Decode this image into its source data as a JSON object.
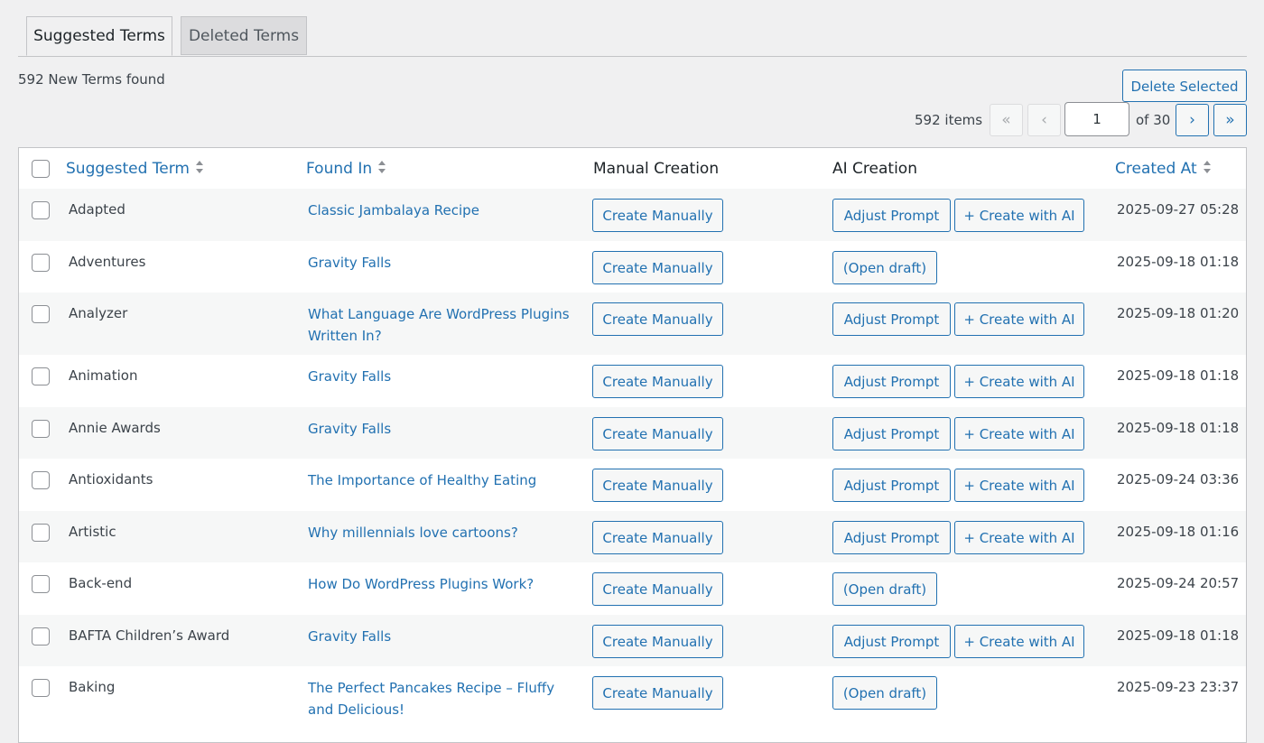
{
  "tabs": {
    "suggested": "Suggested Terms",
    "deleted": "Deleted Terms"
  },
  "summary": "592 New Terms found",
  "actions": {
    "delete_selected": "Delete Selected"
  },
  "pagination": {
    "items": "592 items",
    "first": "«",
    "prev": "‹",
    "current_page": "1",
    "of_total": "of 30",
    "next": "›",
    "last": "»"
  },
  "columns": {
    "suggested_term": "Suggested Term",
    "found_in": "Found In",
    "manual_creation": "Manual Creation",
    "ai_creation": "AI Creation",
    "created_at": "Created At"
  },
  "buttons": {
    "create_manually": "Create Manually",
    "adjust_prompt": "Adjust Prompt",
    "create_with_ai": "+ Create with AI",
    "open_draft": "(Open draft)"
  },
  "rows": [
    {
      "term": "Adapted",
      "found_in": "Classic Jambalaya Recipe",
      "draft": false,
      "created_at": "2025-09-27 05:28"
    },
    {
      "term": "Adventures",
      "found_in": "Gravity Falls",
      "draft": true,
      "created_at": "2025-09-18 01:18"
    },
    {
      "term": "Analyzer",
      "found_in": "What Language Are WordPress Plugins Written In?",
      "draft": false,
      "created_at": "2025-09-18 01:20"
    },
    {
      "term": "Animation",
      "found_in": "Gravity Falls",
      "draft": false,
      "created_at": "2025-09-18 01:18"
    },
    {
      "term": "Annie Awards",
      "found_in": "Gravity Falls",
      "draft": false,
      "created_at": "2025-09-18 01:18"
    },
    {
      "term": "Antioxidants",
      "found_in": "The Importance of Healthy Eating",
      "draft": false,
      "created_at": "2025-09-24 03:36"
    },
    {
      "term": "Artistic",
      "found_in": "Why millennials love cartoons?",
      "draft": false,
      "created_at": "2025-09-18 01:16"
    },
    {
      "term": "Back-end",
      "found_in": "How Do WordPress Plugins Work?",
      "draft": true,
      "created_at": "2025-09-24 20:57"
    },
    {
      "term": "BAFTA Children’s Award",
      "found_in": "Gravity Falls",
      "draft": false,
      "created_at": "2025-09-18 01:18"
    },
    {
      "term": "Baking",
      "found_in": "The Perfect Pancakes Recipe – Fluffy and Delicious!",
      "draft": true,
      "created_at": "2025-09-23 23:37"
    }
  ]
}
